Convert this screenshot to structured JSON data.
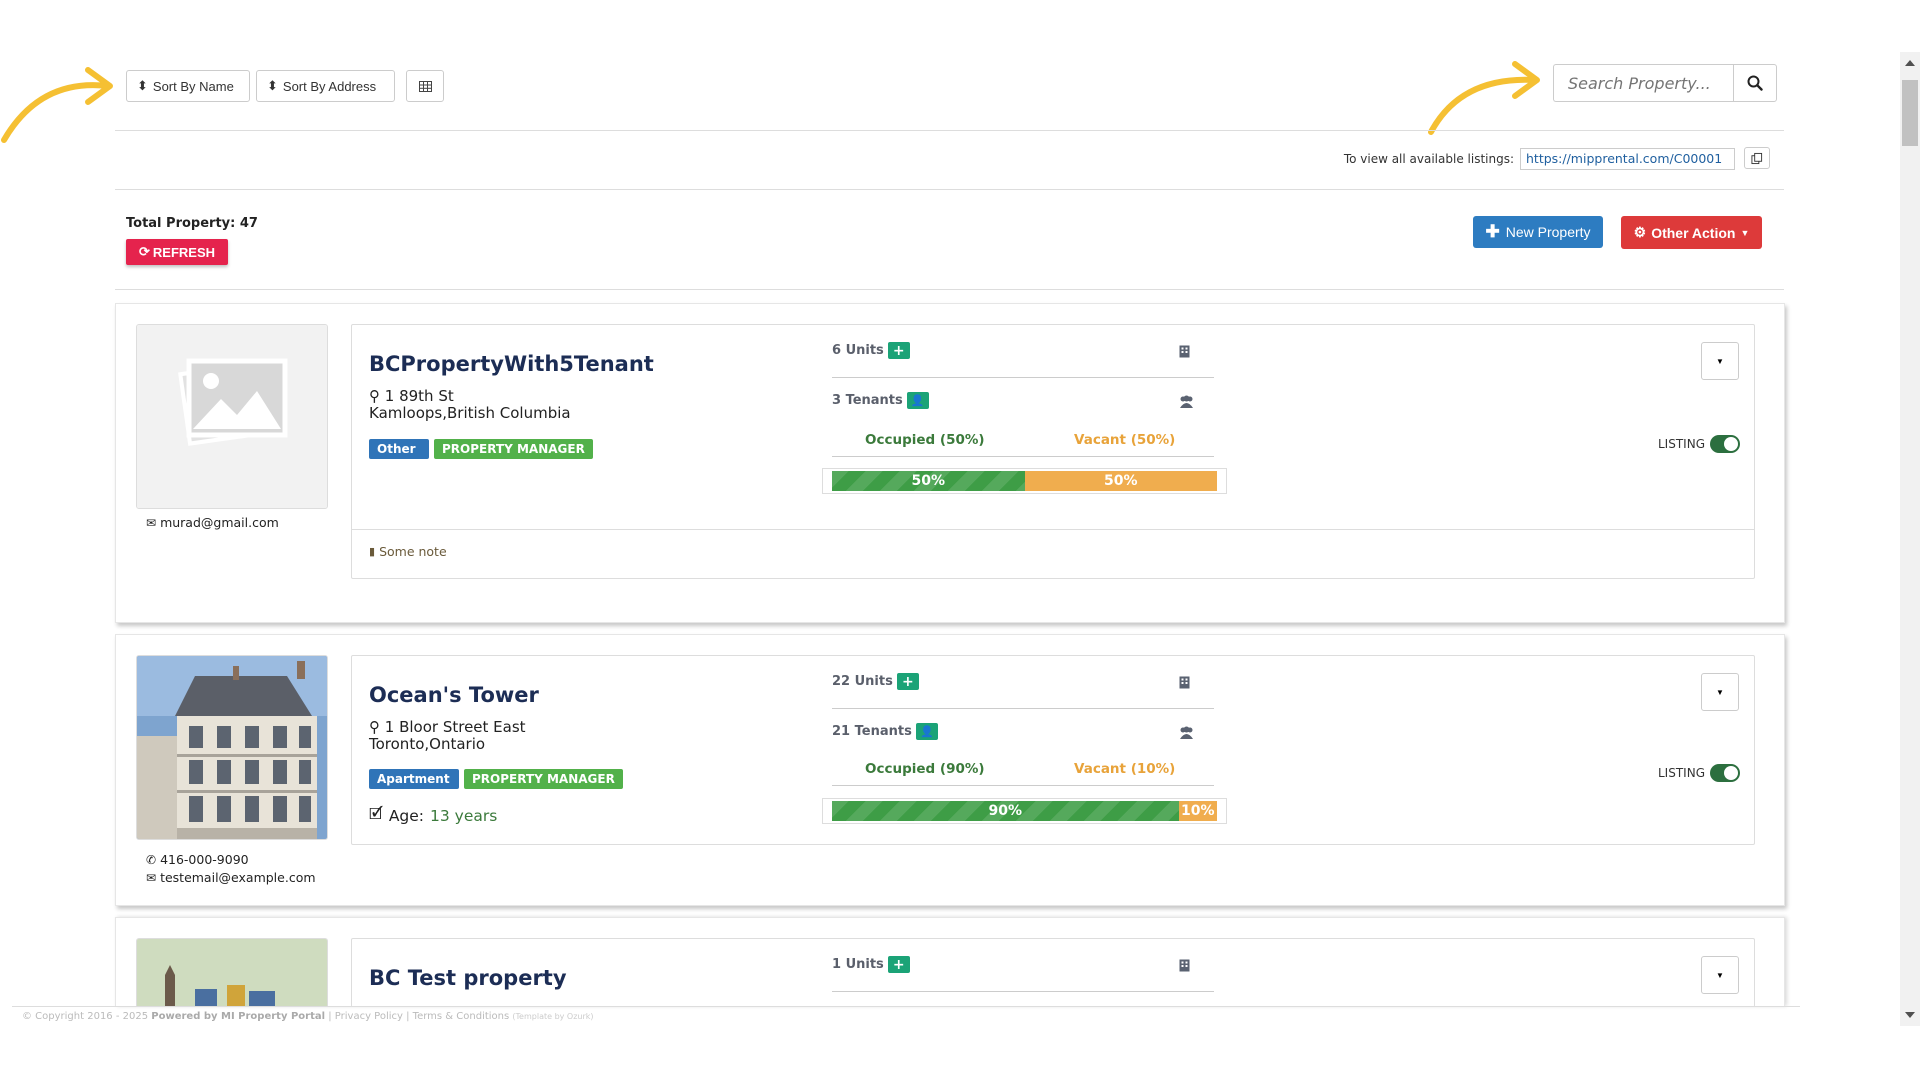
{
  "toolbar": {
    "sort_name_label": "Sort By Name",
    "sort_address_label": "Sort By Address",
    "search_placeholder": "Search Property..."
  },
  "listings": {
    "label": "To view all available listings:",
    "url": "https://mipprental.com/C00001"
  },
  "summary": {
    "total_label": "Total Property: 47",
    "refresh_label": "REFRESH",
    "new_property_label": "New Property",
    "other_action_label": "Other Action"
  },
  "properties": [
    {
      "name": "BCPropertyWith5Tenant",
      "address_line1": "1 89th St",
      "address_line2": "Kamloops,British Columbia",
      "type_tag": "Other",
      "role_tag": "PROPERTY MANAGER",
      "units": "6 Units",
      "tenants": "3 Tenants",
      "occupied_label": "Occupied (50%)",
      "vacant_label": "Vacant (50%)",
      "occupied_pct": 50,
      "vacant_pct": 50,
      "occupied_text": "50%",
      "vacant_text": "50%",
      "email": "murad@gmail.com",
      "note": "Some note",
      "listing_label": "LISTING"
    },
    {
      "name": "Ocean's Tower",
      "address_line1": "1 Bloor Street East",
      "address_line2": "Toronto,Ontario",
      "type_tag": "Apartment",
      "role_tag": "PROPERTY MANAGER",
      "age_label": "Age:",
      "age_value": "13 years",
      "units": "22 Units",
      "tenants": "21 Tenants",
      "occupied_label": "Occupied (90%)",
      "vacant_label": "Vacant (10%)",
      "occupied_pct": 90,
      "vacant_pct": 10,
      "occupied_text": "90%",
      "vacant_text": "10%",
      "phone": "416-000-9090",
      "email": "testemail@example.com",
      "listing_label": "LISTING"
    },
    {
      "name": "BC Test property",
      "units": "1 Units"
    }
  ],
  "footer": {
    "copyright": "© Copyright 2016 - 2025",
    "powered": "Powered by MI Property Portal",
    "privacy": "| Privacy Policy",
    "terms": "| Terms & Conditions",
    "template": "(Template by Ozurk)"
  },
  "colors": {
    "refresh": "#e5234d",
    "new_property": "#2d7cc1",
    "other_action": "#dd3a3a",
    "occupied": "#3e9d46",
    "vacant": "#f0ad4e",
    "tag_blue": "#2f74b8",
    "tag_green": "#52b14a",
    "plus_badge": "#1ba377"
  }
}
